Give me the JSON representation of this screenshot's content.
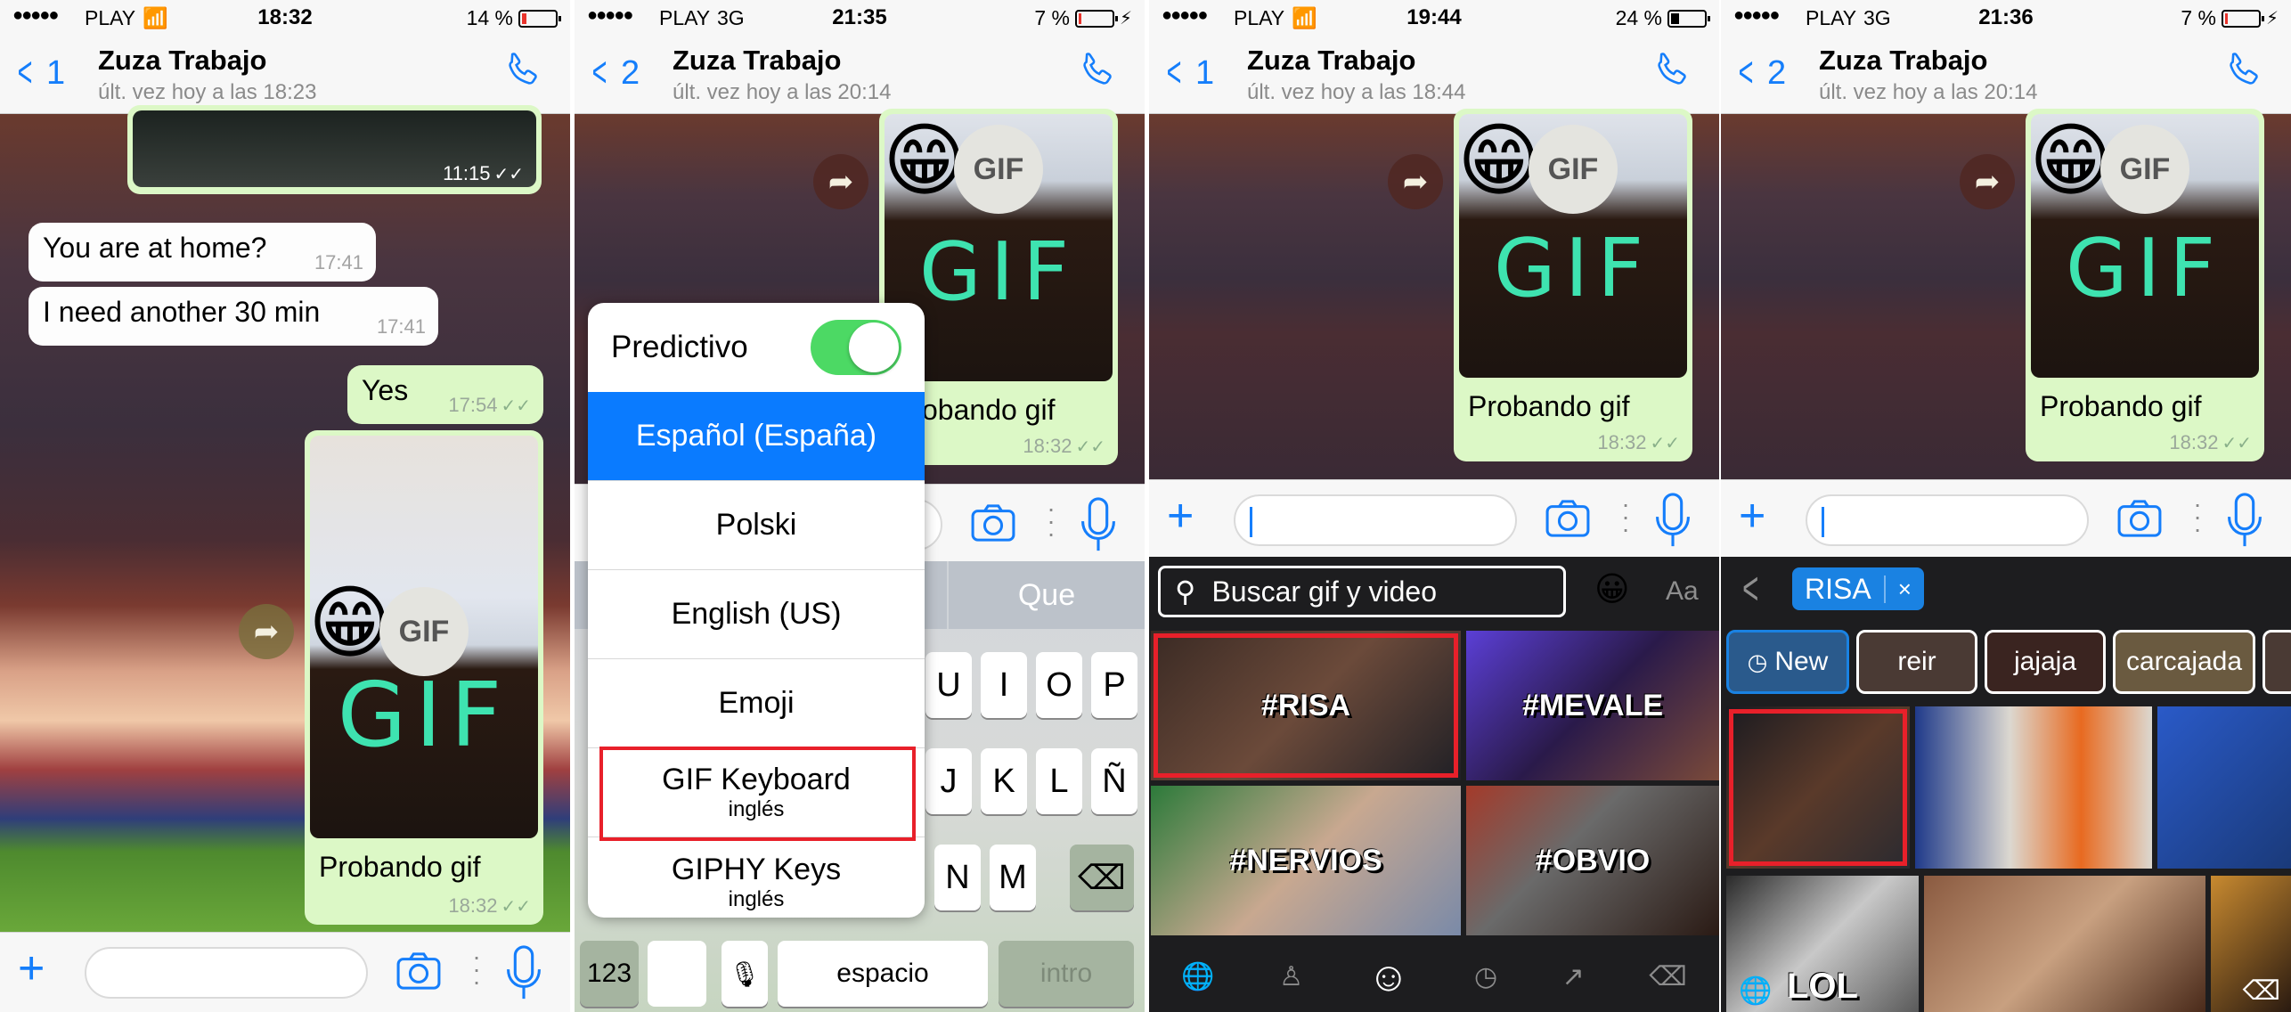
{
  "panels": [
    {
      "status": {
        "carrier": "PLAY",
        "network": "wifi",
        "time": "18:32",
        "battery": "14 %",
        "battery_level": 0.14,
        "charging": false
      },
      "nav": {
        "back_count": "1",
        "title": "Zuza Trabajo",
        "subtitle": "últ. vez hoy a las 18:23"
      },
      "messages": [
        {
          "type": "image",
          "direction": "out",
          "time": "11:15"
        },
        {
          "type": "text",
          "direction": "in",
          "text": "You are at home?",
          "time": "17:41"
        },
        {
          "type": "text",
          "direction": "in",
          "text": "I need another 30 min",
          "time": "17:41"
        },
        {
          "type": "text",
          "direction": "out",
          "text": "Yes",
          "time": "17:54"
        },
        {
          "type": "gif",
          "direction": "out",
          "caption": "Probando gif",
          "badge": "GIF",
          "drawn_text": "GIF",
          "time": "18:32"
        }
      ]
    },
    {
      "status": {
        "carrier": "PLAY",
        "network": "3G",
        "time": "21:35",
        "battery": "7 %",
        "battery_level": 0.07,
        "charging": true
      },
      "nav": {
        "back_count": "2",
        "title": "Zuza Trabajo",
        "subtitle": "últ. vez hoy a las 20:14"
      },
      "gif_message": {
        "caption": "Probando gif",
        "badge": "GIF",
        "drawn_text": "GIF",
        "time": "18:32"
      },
      "keyboard_menu": {
        "predictive_label": "Predictivo",
        "predictive_on": true,
        "items": [
          {
            "label": "Español (España)",
            "sub": "",
            "selected": true
          },
          {
            "label": "Polski",
            "sub": ""
          },
          {
            "label": "English (US)",
            "sub": ""
          },
          {
            "label": "Emoji",
            "sub": ""
          },
          {
            "label": "GIF Keyboard",
            "sub": "inglés",
            "highlighted": true
          },
          {
            "label": "GIPHY Keys",
            "sub": "inglés"
          }
        ]
      },
      "keyboard": {
        "suggestion": "Que",
        "row1": [
          "U",
          "I",
          "O",
          "P"
        ],
        "row2": [
          "J",
          "K",
          "L",
          "Ñ"
        ],
        "row3": [
          "N",
          "M"
        ],
        "num_key": "123",
        "space_key": "espacio",
        "return_key": "intro"
      }
    },
    {
      "status": {
        "carrier": "PLAY",
        "network": "wifi",
        "time": "19:44",
        "battery": "24 %",
        "battery_level": 0.24,
        "charging": false
      },
      "nav": {
        "back_count": "1",
        "title": "Zuza Trabajo",
        "subtitle": "últ. vez hoy a las 18:44"
      },
      "gif_message": {
        "caption": "Probando gif",
        "badge": "GIF",
        "drawn_text": "GIF",
        "time": "18:32"
      },
      "gif_keyboard": {
        "search_placeholder": "Buscar gif y video",
        "aa_label": "Aa",
        "tiles": [
          {
            "label": "#RISA",
            "highlighted": true
          },
          {
            "label": "#MEVALE"
          },
          {
            "label": "#NERVIOS"
          },
          {
            "label": "#OBVIO"
          }
        ]
      }
    },
    {
      "status": {
        "carrier": "PLAY",
        "network": "3G",
        "time": "21:36",
        "battery": "7 %",
        "battery_level": 0.07,
        "charging": true
      },
      "nav": {
        "back_count": "2",
        "title": "Zuza Trabajo",
        "subtitle": "últ. vez hoy a las 20:14"
      },
      "gif_message": {
        "caption": "Probando gif",
        "badge": "GIF",
        "drawn_text": "GIF",
        "time": "18:32"
      },
      "gif_results": {
        "search_tag": "RISA",
        "clear_label": "×",
        "chips": [
          "New",
          "reir",
          "jajaja",
          "carcajada"
        ],
        "tile_labels": [
          "",
          "",
          "",
          "LOL",
          "",
          ""
        ]
      }
    }
  ]
}
